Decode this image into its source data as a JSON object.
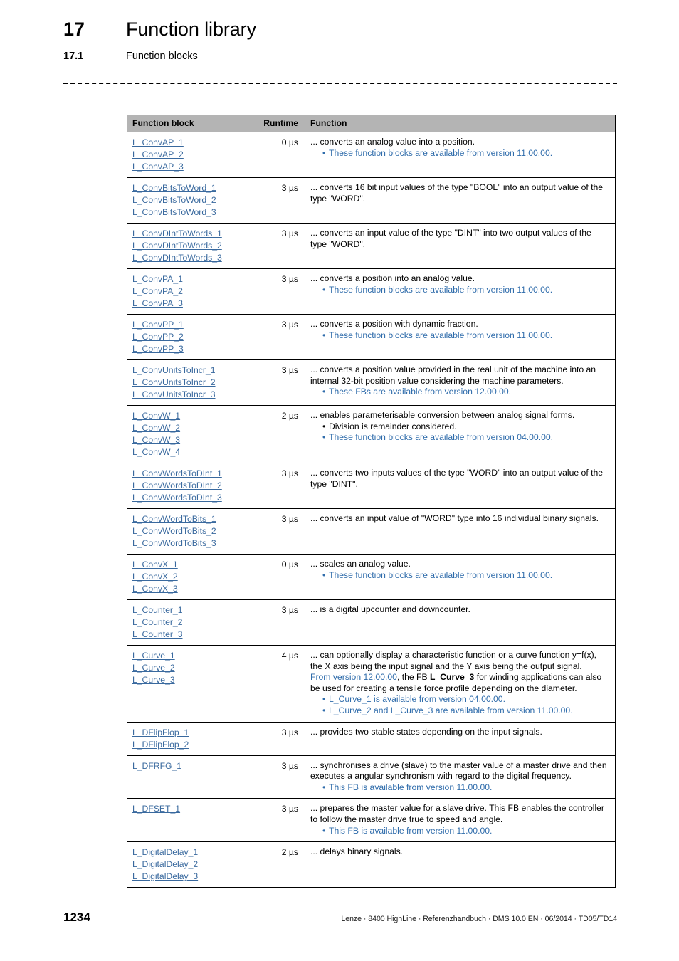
{
  "header": {
    "chapter_number": "17",
    "chapter_title": "Function library",
    "section_number": "17.1",
    "section_title": "Function blocks"
  },
  "table": {
    "columns": {
      "function_block": "Function block",
      "runtime": "Runtime",
      "function": "Function"
    },
    "rows": [
      {
        "blocks": [
          "L_ConvAP_1",
          "L_ConvAP_2",
          "L_ConvAP_3"
        ],
        "runtime": "0 µs",
        "text": "... converts an analog value into a position.",
        "bullets": [
          {
            "text": "These function blocks are available from version 11.00.00.",
            "style": "blue"
          }
        ]
      },
      {
        "blocks": [
          "L_ConvBitsToWord_1",
          "L_ConvBitsToWord_2",
          "L_ConvBitsToWord_3"
        ],
        "runtime": "3 µs",
        "text": "... converts 16 bit input values of the type \"BOOL\" into an output value of the type \"WORD\".",
        "bullets": []
      },
      {
        "blocks": [
          "L_ConvDIntToWords_1",
          "L_ConvDIntToWords_2",
          "L_ConvDIntToWords_3"
        ],
        "runtime": "3 µs",
        "text": "... converts an input value of the type \"DINT\" into two output values of the type \"WORD\".",
        "bullets": []
      },
      {
        "blocks": [
          "L_ConvPA_1",
          "L_ConvPA_2",
          "L_ConvPA_3"
        ],
        "runtime": "3 µs",
        "text": "... converts a position into an analog value.",
        "bullets": [
          {
            "text": "These function blocks are available from version 11.00.00.",
            "style": "blue"
          }
        ]
      },
      {
        "blocks": [
          "L_ConvPP_1",
          "L_ConvPP_2",
          "L_ConvPP_3"
        ],
        "runtime": "3 µs",
        "text": "... converts a position with dynamic fraction.",
        "bullets": [
          {
            "text": "These function blocks are available from version 11.00.00.",
            "style": "blue"
          }
        ]
      },
      {
        "blocks": [
          "L_ConvUnitsToIncr_1",
          "L_ConvUnitsToIncr_2",
          "L_ConvUnitsToIncr_3"
        ],
        "runtime": "3 µs",
        "text": "... converts a position value provided in the real unit of the machine into an internal 32-bit position value considering the machine parameters.",
        "bullets": [
          {
            "text": "These FBs are available from version 12.00.00.",
            "style": "blue"
          }
        ]
      },
      {
        "blocks": [
          "L_ConvW_1",
          "L_ConvW_2",
          "L_ConvW_3",
          "L_ConvW_4"
        ],
        "runtime": "2 µs",
        "text": "... enables parameterisable conversion between analog signal forms.",
        "bullets": [
          {
            "text": "Division is remainder considered.",
            "style": "black"
          },
          {
            "text": "These function blocks are available from version 04.00.00.",
            "style": "blue"
          }
        ]
      },
      {
        "blocks": [
          "L_ConvWordsToDInt_1",
          "L_ConvWordsToDInt_2",
          "L_ConvWordsToDInt_3"
        ],
        "runtime": "3 µs",
        "text": "... converts two inputs values of the type \"WORD\" into an output value of the type \"DINT\".",
        "bullets": []
      },
      {
        "blocks": [
          "L_ConvWordToBits_1",
          "L_ConvWordToBits_2",
          "L_ConvWordToBits_3"
        ],
        "runtime": "3 µs",
        "text": "... converts an input value of \"WORD\" type into 16 individual binary signals.",
        "bullets": []
      },
      {
        "blocks": [
          "L_ConvX_1",
          "L_ConvX_2",
          "L_ConvX_3"
        ],
        "runtime": "0 µs",
        "text": "... scales an analog value.",
        "bullets": [
          {
            "text": "These function blocks are available from version 11.00.00.",
            "style": "blue"
          }
        ]
      },
      {
        "blocks": [
          "L_Counter_1",
          "L_Counter_2",
          "L_Counter_3"
        ],
        "runtime": "3 µs",
        "text": "... is a digital upcounter and downcounter.",
        "bullets": []
      },
      {
        "blocks": [
          "L_Curve_1",
          "L_Curve_2",
          "L_Curve_3"
        ],
        "runtime": "4 µs",
        "text": "... can optionally display a characteristic function or a curve function y=f(x), the X axis being the input signal and the Y axis being the output signal.",
        "rich_paragraph": {
          "blue_lead": "From version 12.00.00",
          "after_lead": ", the FB ",
          "bold_term": "L_Curve_3",
          "tail": " for winding applications can also be used for creating a tensile force profile depending on the diameter."
        },
        "bullets": [
          {
            "text": "L_Curve_1 is available from version 04.00.00.",
            "style": "blue"
          },
          {
            "text": "L_Curve_2 and L_Curve_3 are available from version 11.00.00.",
            "style": "blue"
          }
        ]
      },
      {
        "blocks": [
          "L_DFlipFlop_1",
          "L_DFlipFlop_2"
        ],
        "runtime": "3 µs",
        "text": "... provides two stable states depending on the input signals.",
        "bullets": []
      },
      {
        "blocks": [
          "L_DFRFG_1"
        ],
        "runtime": "3 µs",
        "text": "... synchronises a drive (slave) to the master value of a master drive and then executes a angular synchronism with regard to the digital frequency.",
        "bullets": [
          {
            "text": "This FB is available from version 11.00.00.",
            "style": "blue"
          }
        ]
      },
      {
        "blocks": [
          "L_DFSET_1"
        ],
        "runtime": "3 µs",
        "text": "... prepares the master value for a slave drive. This FB enables the controller to follow the master drive true to speed and angle.",
        "bullets": [
          {
            "text": "This FB is available from version 11.00.00.",
            "style": "blue"
          }
        ]
      },
      {
        "blocks": [
          "L_DigitalDelay_1",
          "L_DigitalDelay_2",
          "L_DigitalDelay_3"
        ],
        "runtime": "2 µs",
        "text": "... delays binary signals.",
        "bullets": []
      }
    ]
  },
  "footer": {
    "page_number": "1234",
    "note": "Lenze · 8400 HighLine · Referenzhandbuch · DMS 10.0 EN · 06/2014 · TD05/TD14"
  },
  "colors": {
    "link": "#39699e",
    "accent_blue": "#2f6cab",
    "header_bg": "#b4b4b4"
  }
}
